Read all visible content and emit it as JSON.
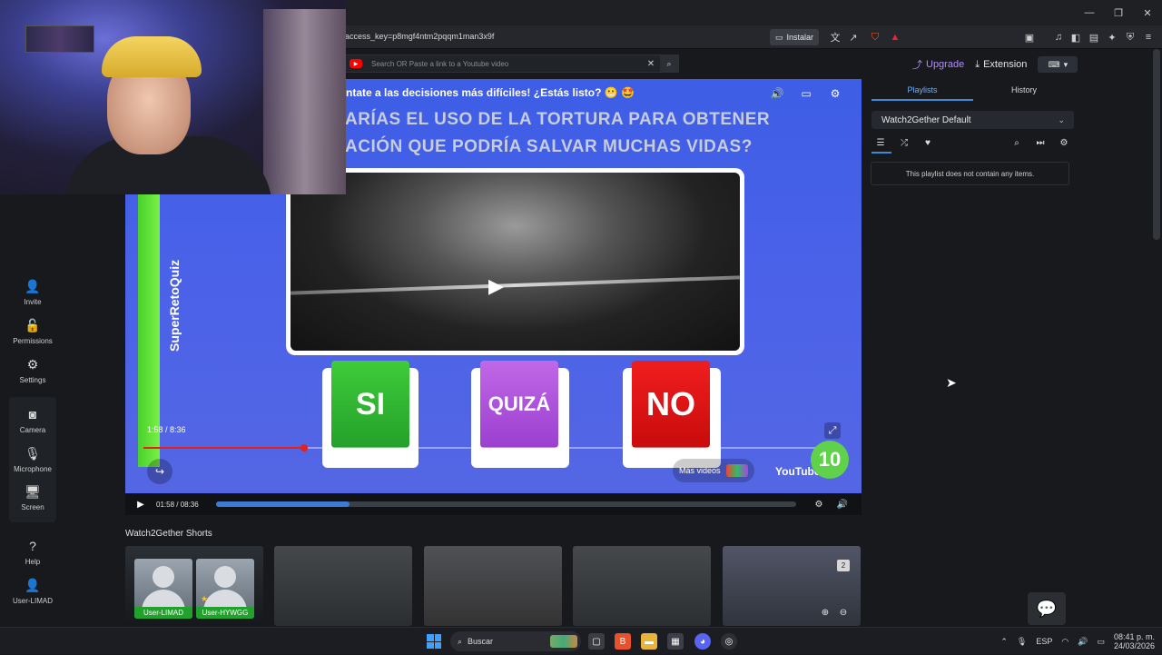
{
  "browser": {
    "url": "access_key=p8mgf4ntm2pqqm1man3x9f",
    "install_label": "Instalar"
  },
  "search": {
    "placeholder": "Search OR Paste a link to a Youtube video"
  },
  "sidebar": {
    "items": [
      {
        "label": "Invite",
        "icon": "add-user-icon"
      },
      {
        "label": "Permissions",
        "icon": "unlock-icon"
      },
      {
        "label": "Settings",
        "icon": "gear-icon"
      },
      {
        "label": "Camera",
        "icon": "camera-icon"
      },
      {
        "label": "Microphone",
        "icon": "microphone-icon"
      },
      {
        "label": "Screen",
        "icon": "monitor-icon"
      },
      {
        "label": "Help",
        "icon": "help-icon"
      },
      {
        "label": "User-LIMAD",
        "icon": "user-icon"
      }
    ]
  },
  "video": {
    "title": "ntate a las decisiones más difíciles! ¿Estás listo? 😬 🤩",
    "question_line1": "ARÍAS EL USO DE LA TORTURA PARA OBTENER",
    "question_line2": "ACIÓN QUE PODRÍA SALVAR MUCHAS VIDAS?",
    "brand": "SuperRetoQuiz",
    "answers": {
      "si": "SI",
      "quiza": "QUIZÁ",
      "no": "NO"
    },
    "inner_time": "1:58 / 8:36",
    "inner_progress": 0.23,
    "mas_videos": "Más videos",
    "youtube": "YouTube",
    "countdown": "10"
  },
  "player": {
    "time": "01:58 / 08:36",
    "progress": 0.23
  },
  "shorts": {
    "title": "Watch2Gether Shorts",
    "badge": "2",
    "users": [
      "User-LIMAD",
      "User-HYWGG"
    ]
  },
  "right_panel": {
    "upgrade": "Upgrade",
    "extension": "Extension",
    "tabs": [
      "Playlists",
      "History"
    ],
    "playlist_name": "Watch2Gether Default",
    "empty_message": "This playlist does not contain any items."
  },
  "taskbar": {
    "search": "Buscar",
    "lang": "ESP",
    "time": "08:41 p. m.",
    "date": "24/03/2026"
  },
  "colors": {
    "accent": "#3d8bd6",
    "upgrade": "#b18bff",
    "video_bg": "#4b62e8",
    "progress_red": "#e62117"
  }
}
